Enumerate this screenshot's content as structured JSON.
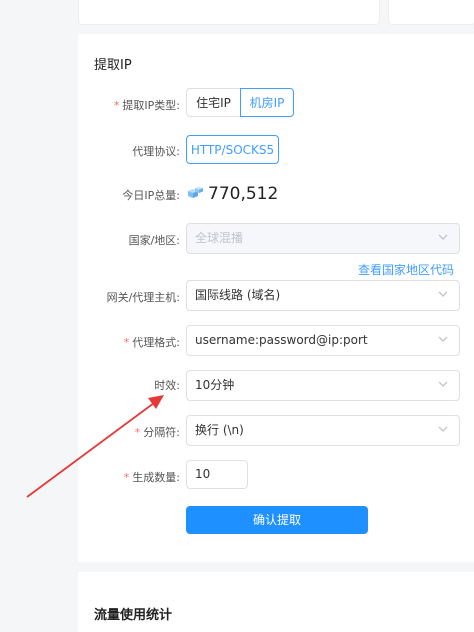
{
  "section_title": "提取IP",
  "extract_type": {
    "label": "提取IP类型:",
    "options": [
      "住宅IP",
      "机房IP"
    ],
    "selected": "机房IP"
  },
  "protocol": {
    "label": "代理协议:",
    "value": "HTTP/SOCKS5"
  },
  "total": {
    "label": "今日IP总量:",
    "value": "770,512"
  },
  "country": {
    "label": "国家/地区:",
    "placeholder": "全球混播",
    "link": "查看国家地区代码"
  },
  "gateway": {
    "label": "网关/代理主机:",
    "value": "国际线路 (域名)"
  },
  "format": {
    "label": "代理格式:",
    "value": "username:password@ip:port"
  },
  "validity": {
    "label": "时效:",
    "value": "10分钟"
  },
  "separator": {
    "label": "分隔符:",
    "value": "换行 (\\n)"
  },
  "quantity": {
    "label": "生成数量:",
    "value": "10"
  },
  "submit_label": "确认提取",
  "next_section_title": "流量使用统计",
  "colors": {
    "accent": "#409eff",
    "button": "#1e90ff",
    "arrow": "#e53935",
    "required": "#f56c6c"
  },
  "icons": {
    "total": "cube-stack-icon",
    "dropdown": "chevron-down-icon"
  }
}
